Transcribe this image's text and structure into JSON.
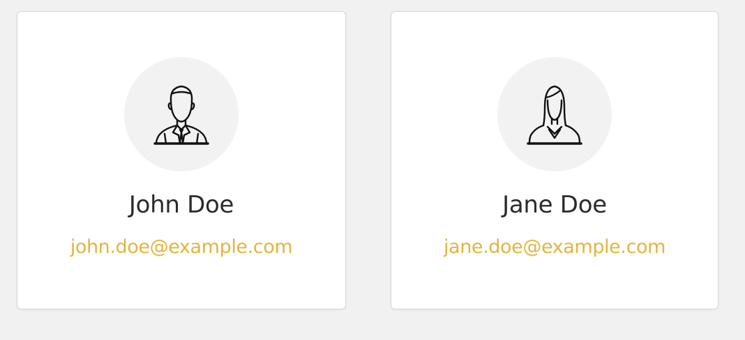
{
  "theme": {
    "page_background": "#f1f1f1",
    "card_background": "#ffffff",
    "avatar_background": "#f2f2f2",
    "email_color": "#e2b53f",
    "name_color": "#2b2b2b"
  },
  "contacts": [
    {
      "name": "John Doe",
      "email": "john.doe@example.com",
      "avatar_icon": "male-user-icon"
    },
    {
      "name": "Jane Doe",
      "email": "jane.doe@example.com",
      "avatar_icon": "female-user-icon"
    }
  ]
}
